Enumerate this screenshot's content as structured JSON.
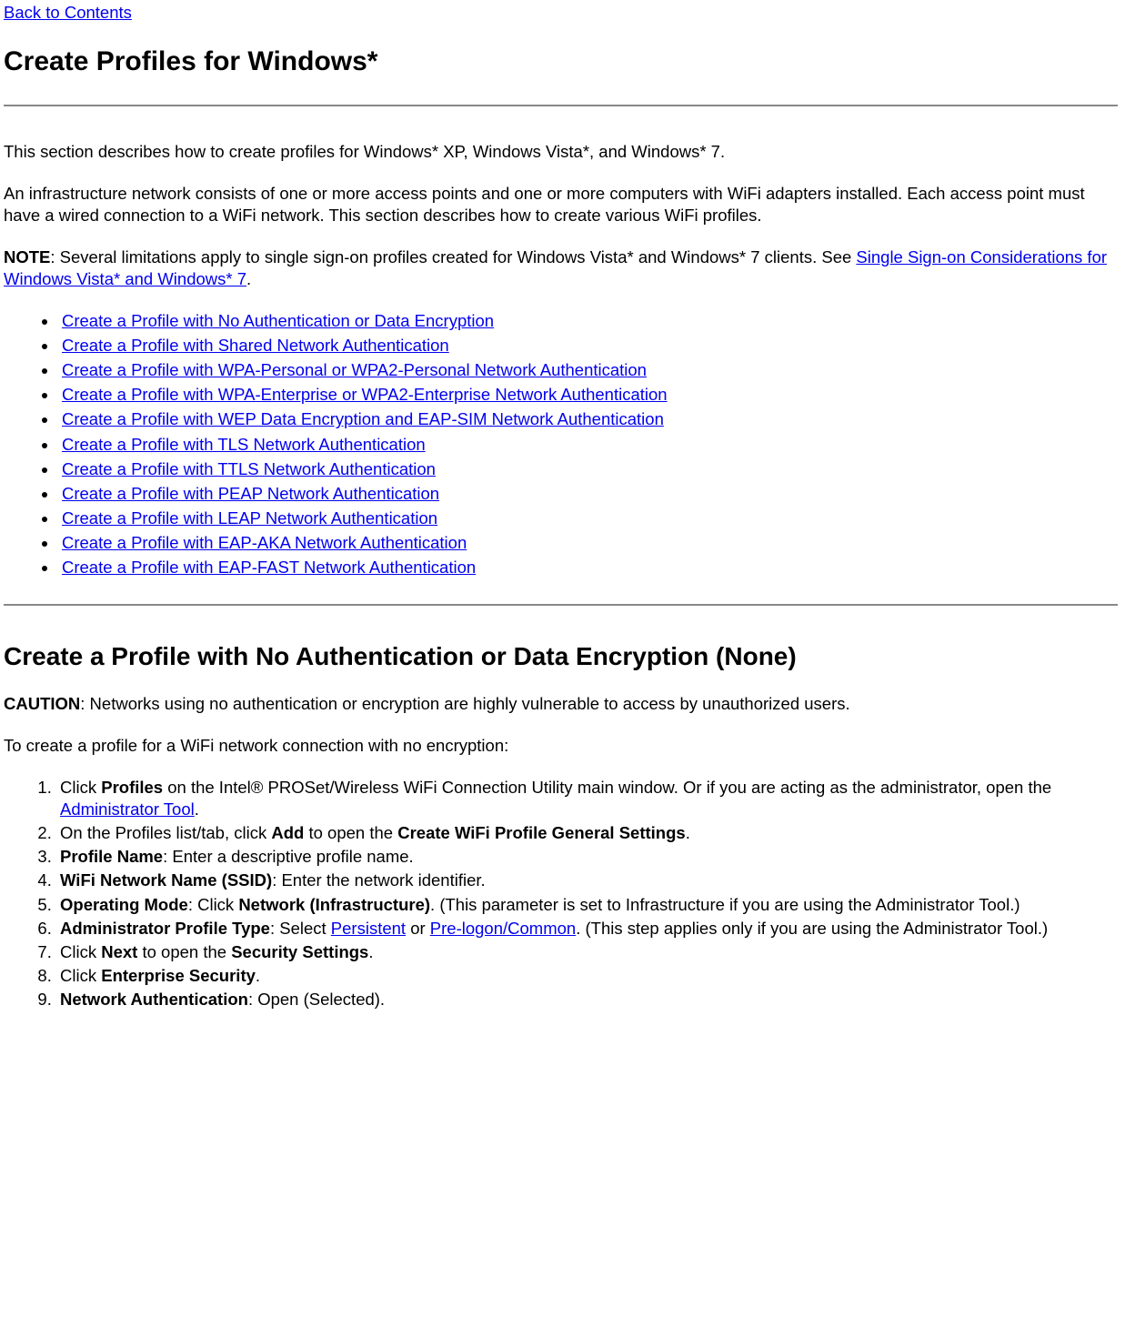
{
  "nav": {
    "back_to_contents": "Back to Contents"
  },
  "heading_main": "Create Profiles for Windows*",
  "intro1": "This section describes how to create profiles for Windows* XP, Windows Vista*, and Windows* 7.",
  "intro2": "An infrastructure network consists of one or more access points and one or more computers with WiFi adapters installed. Each access point must have a wired connection to a WiFi network. This section describes how to create various WiFi profiles.",
  "note": {
    "label": "NOTE",
    "before": ": Several limitations apply to single sign-on profiles created for Windows Vista* and Windows* 7 clients. See ",
    "link": "Single Sign-on Considerations for Windows Vista* and Windows* 7",
    "after": "."
  },
  "links": [
    "Create a Profile with No Authentication or Data Encryption",
    "Create a Profile with Shared Network Authentication",
    "Create a Profile with WPA-Personal or WPA2-Personal Network Authentication",
    "Create a Profile with WPA-Enterprise or WPA2-Enterprise Network Authentication",
    "Create a Profile with WEP Data Encryption and EAP-SIM Network Authentication",
    "Create a Profile with TLS Network Authentication",
    "Create a Profile with TTLS Network Authentication",
    "Create a Profile with PEAP Network Authentication",
    "Create a Profile with LEAP Network Authentication",
    "Create a Profile with EAP-AKA Network Authentication",
    "Create a Profile with EAP-FAST Network Authentication"
  ],
  "heading_section": "Create a Profile with No Authentication or Data Encryption (None)",
  "caution": {
    "label": "CAUTION",
    "text": ": Networks using no authentication or encryption are highly vulnerable to access by unauthorized users."
  },
  "lead_in": "To create a profile for a WiFi network connection with no encryption:",
  "steps": {
    "s1_a": "Click ",
    "s1_b": "Profiles",
    "s1_c": " on the Intel® PROSet/Wireless WiFi Connection Utility main window. Or if you are acting as the administrator, open the ",
    "s1_link": "Administrator Tool",
    "s1_d": ".",
    "s2_a": "On the Profiles list/tab, click ",
    "s2_b": "Add",
    "s2_c": " to open the ",
    "s2_d": "Create WiFi Profile General Settings",
    "s2_e": ".",
    "s3_a": "Profile Name",
    "s3_b": ": Enter a descriptive profile name.",
    "s4_a": "WiFi Network Name (SSID)",
    "s4_b": ": Enter the network identifier.",
    "s5_a": "Operating Mode",
    "s5_b": ": Click ",
    "s5_c": "Network (Infrastructure)",
    "s5_d": ". (This parameter is set to Infrastructure if you are using the Administrator Tool.)",
    "s6_a": "Administrator Profile Type",
    "s6_b": ": Select ",
    "s6_link1": "Persistent",
    "s6_c": " or ",
    "s6_link2": "Pre-logon/Common",
    "s6_d": ". (This step applies only if you are using the Administrator Tool.)",
    "s7_a": "Click ",
    "s7_b": "Next",
    "s7_c": " to open the ",
    "s7_d": "Security Settings",
    "s7_e": ".",
    "s8_a": "Click ",
    "s8_b": "Enterprise Security",
    "s8_c": ".",
    "s9_a": "Network Authentication",
    "s9_b": ": Open (Selected)."
  }
}
